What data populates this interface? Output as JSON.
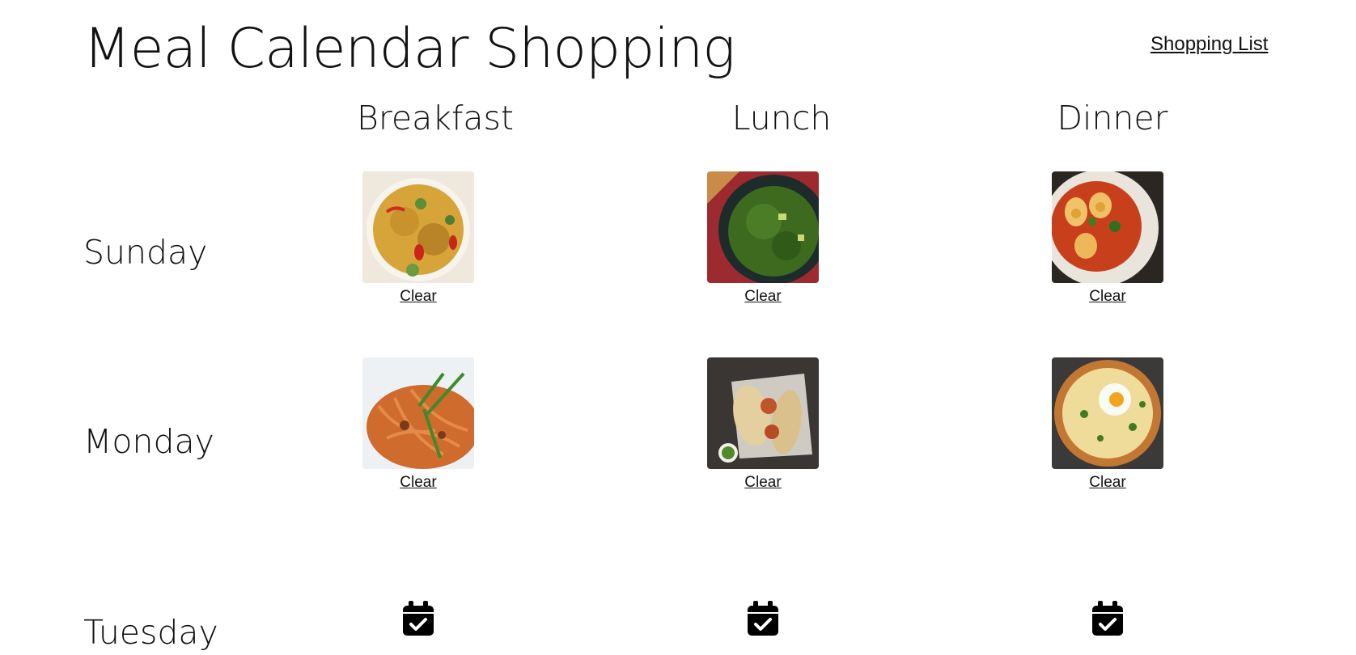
{
  "header": {
    "title": "Meal Calendar Shopping",
    "nav_link": "Shopping List"
  },
  "columns": [
    "Breakfast",
    "Lunch",
    "Dinner"
  ],
  "days": [
    {
      "name": "Sunday",
      "meals": [
        {
          "slot": "Breakfast",
          "filled": true,
          "image": "fried-rice-bowl-image",
          "action": "Clear"
        },
        {
          "slot": "Lunch",
          "filled": true,
          "image": "spinach-curry-image",
          "action": "Clear"
        },
        {
          "slot": "Dinner",
          "filled": true,
          "image": "egg-curry-image",
          "action": "Clear"
        }
      ]
    },
    {
      "name": "Monday",
      "meals": [
        {
          "slot": "Breakfast",
          "filled": true,
          "image": "spaghetti-image",
          "action": "Clear"
        },
        {
          "slot": "Lunch",
          "filled": true,
          "image": "wraps-image",
          "action": "Clear"
        },
        {
          "slot": "Dinner",
          "filled": true,
          "image": "egg-flatbread-image",
          "action": "Clear"
        }
      ]
    },
    {
      "name": "Tuesday",
      "meals": [
        {
          "slot": "Breakfast",
          "filled": false,
          "icon": "calendar-check-icon"
        },
        {
          "slot": "Lunch",
          "filled": false,
          "icon": "calendar-check-icon"
        },
        {
          "slot": "Dinner",
          "filled": false,
          "icon": "calendar-check-icon"
        }
      ]
    }
  ]
}
